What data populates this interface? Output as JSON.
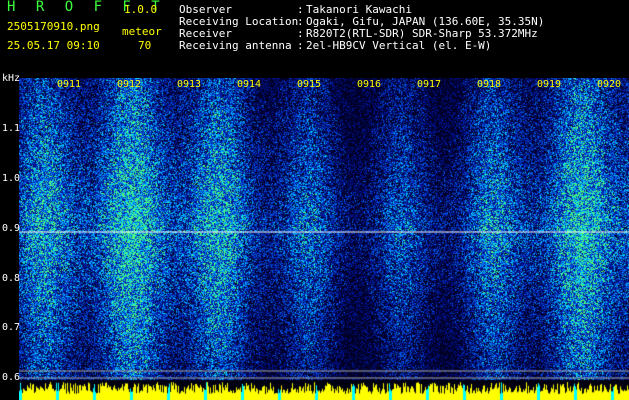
{
  "header": {
    "app_title": "H R O F F T",
    "app_version": "1.0.0",
    "file_name": "2505170910.png",
    "mode_label": "meteor",
    "timestamp": "25.05.17 09:10",
    "count": "70",
    "info": [
      {
        "key": "Observer",
        "value": "Takanori Kawachi"
      },
      {
        "key": "Receiving Location",
        "value": "Ogaki, Gifu, JAPAN (136.60E, 35.35N)"
      },
      {
        "key": "Receiver",
        "value": "R820T2(RTL-SDR) SDR-Sharp 53.372MHz"
      },
      {
        "key": "Receiving antenna",
        "value": "2el-HB9CV Vertical (el. E-W)"
      }
    ],
    "separator": ":"
  },
  "spectrogram": {
    "y_unit": "kHz",
    "y_ticks": [
      "1.1",
      "1.0",
      "0.9",
      "0.8",
      "0.7",
      "0.6"
    ],
    "time_labels": [
      "0911",
      "0912",
      "0913",
      "0914",
      "0915",
      "0916",
      "0917",
      "0918",
      "0919",
      "0920"
    ],
    "colors": {
      "background": "#000010",
      "tick_label": "#ffff00",
      "signal_line": "#ffffff",
      "level_bar": "#ffff00",
      "level_bar_alt": "#00ffff"
    }
  }
}
